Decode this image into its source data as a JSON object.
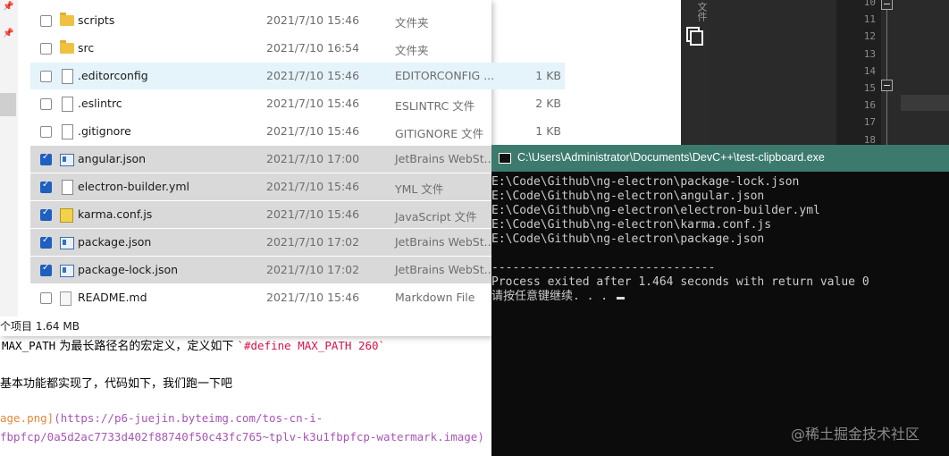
{
  "explorer": {
    "files": [
      {
        "name": "scripts",
        "date": "2021/7/10 15:46",
        "type": "文件夹",
        "size": "",
        "icon": "folder-icon",
        "checked": false,
        "state": "normal"
      },
      {
        "name": "src",
        "date": "2021/7/10 16:54",
        "type": "文件夹",
        "size": "",
        "icon": "folder-icon",
        "checked": false,
        "state": "normal"
      },
      {
        "name": ".editorconfig",
        "date": "2021/7/10 15:46",
        "type": "EDITORCONFIG ...",
        "size": "1 KB",
        "icon": "document-icon",
        "checked": false,
        "state": "hover"
      },
      {
        "name": ".eslintrc",
        "date": "2021/7/10 15:46",
        "type": "ESLINTRC 文件",
        "size": "2 KB",
        "icon": "document-icon",
        "checked": false,
        "state": "normal"
      },
      {
        "name": ".gitignore",
        "date": "2021/7/10 15:46",
        "type": "GITIGNORE 文件",
        "size": "1 KB",
        "icon": "document-icon",
        "checked": false,
        "state": "normal"
      },
      {
        "name": "angular.json",
        "date": "2021/7/10 17:00",
        "type": "JetBrains WebSt...",
        "size": "",
        "icon": "json-file-icon",
        "checked": true,
        "state": "selected"
      },
      {
        "name": "electron-builder.yml",
        "date": "2021/7/10 15:46",
        "type": "YML 文件",
        "size": "",
        "icon": "document-icon",
        "checked": true,
        "state": "selected"
      },
      {
        "name": "karma.conf.js",
        "date": "2021/7/10 15:46",
        "type": "JavaScript 文件",
        "size": "",
        "icon": "javascript-file-icon",
        "checked": true,
        "state": "selected"
      },
      {
        "name": "package.json",
        "date": "2021/7/10 17:02",
        "type": "JetBrains WebSt...",
        "size": "",
        "icon": "json-file-icon",
        "checked": true,
        "state": "selected"
      },
      {
        "name": "package-lock.json",
        "date": "2021/7/10 17:02",
        "type": "JetBrains WebSt...",
        "size": "",
        "icon": "json-file-icon",
        "checked": true,
        "state": "selected"
      },
      {
        "name": "README.md",
        "date": "2021/7/10 15:46",
        "type": "Markdown File",
        "size": "",
        "icon": "markdown-file-icon",
        "checked": false,
        "state": "normal"
      }
    ],
    "status": "个项目  1.64 MB"
  },
  "markdown": {
    "line1_code": "MAX_PATH",
    "line1_text": " 为最长路径名的宏定义，定义如下 ",
    "line1_code2": "`#define MAX_PATH 260`",
    "line2": "基本功能都实现了，代码如下，我们跑一下吧",
    "line3_link": "age.png]",
    "line3_url": "(https://p6-juejin.byteimg.com/tos-cn-i-",
    "line4_url": "fbpfcp/0a5d2ac7733d402f88740f50c43fc765~tplv-k3u1fbpfcp-watermark.image)"
  },
  "ide": {
    "side_label": "文件",
    "line_numbers": [
      "10",
      "11",
      "12",
      "13",
      "14",
      "15",
      "16",
      "17",
      "18"
    ]
  },
  "console": {
    "title": "C:\\Users\\Administrator\\Documents\\DevC++\\test-clipboard.exe",
    "lines": [
      "E:\\Code\\Github\\ng-electron\\package-lock.json",
      "E:\\Code\\Github\\ng-electron\\angular.json",
      "E:\\Code\\Github\\ng-electron\\electron-builder.yml",
      "E:\\Code\\Github\\ng-electron\\karma.conf.js",
      "E:\\Code\\Github\\ng-electron\\package.json",
      "",
      "--------------------------------",
      "Process exited after 1.464 seconds with return value 0",
      "请按任意键继续. . . "
    ]
  },
  "watermark": "@稀土掘金技术社区",
  "colors": {
    "console_titlebar": "#3c7a6e",
    "console_bg": "#0c0c0c",
    "selection": "#d9d9d9",
    "hover": "#e5f3fb",
    "checkbox_on": "#1e5fbf"
  }
}
